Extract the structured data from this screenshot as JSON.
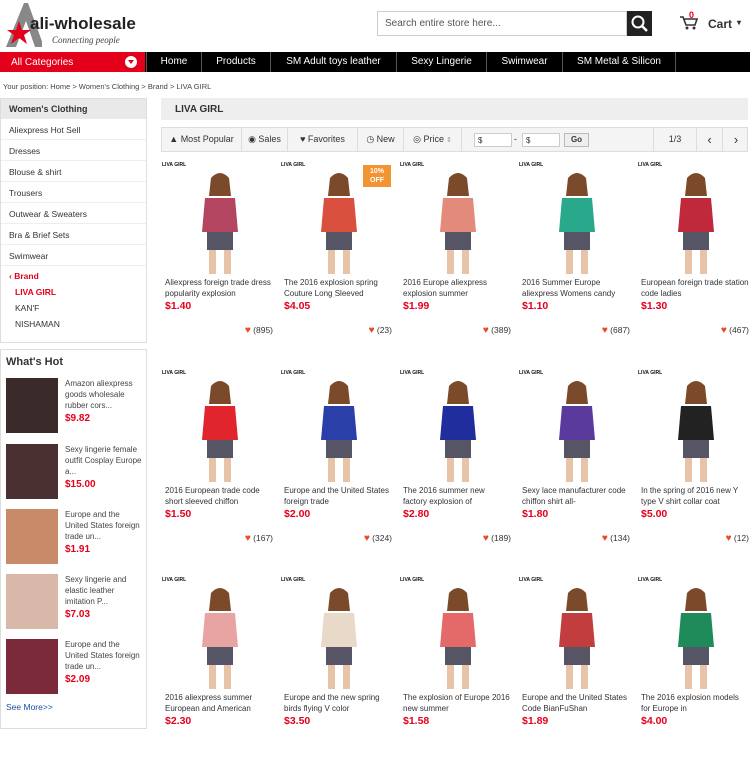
{
  "header": {
    "logo_name": "ali-wholesale",
    "logo_tagline": "Connecting people",
    "search_placeholder": "Search entire store here...",
    "cart_label": "Cart"
  },
  "nav": {
    "all_categories": "All Categories",
    "items": [
      "Home",
      "Products",
      "SM Adult toys leather",
      "Sexy Lingerie",
      "Swimwear",
      "SM Metal & Silicon"
    ]
  },
  "breadcrumb": "Your position: Home > Women's Clothing > Brand > LIVA GIRL",
  "sidebar": {
    "heading": "Women's Clothing",
    "items": [
      "Aliexpress Hot Sell",
      "Dresses",
      "Blouse & shirt",
      "Trousers",
      "Outwear & Sweaters",
      "Bra & Brief Sets",
      "Swimwear"
    ],
    "brand_label": "Brand",
    "brands": [
      "LIVA GIRL",
      "KAN'F",
      "NISHAMAN"
    ]
  },
  "whats_hot": {
    "title": "What's Hot",
    "items": [
      {
        "title": "Amazon aliexpress goods wholesale rubber cors...",
        "price": "$9.82"
      },
      {
        "title": "Sexy lingerie female outfit Cosplay Europe a...",
        "price": "$15.00"
      },
      {
        "title": "Europe and the United States foreign trade un...",
        "price": "$1.91"
      },
      {
        "title": "Sexy lingerie and elastic leather imitation P...",
        "price": "$7.03"
      },
      {
        "title": "Europe and the United States foreign trade un...",
        "price": "$2.09"
      }
    ],
    "see_more": "See More>>"
  },
  "listing": {
    "title": "LIVA GIRL",
    "sort": {
      "most_popular": "Most Popular",
      "sales": "Sales",
      "favorites": "Favorites",
      "new": "New",
      "price": "Price",
      "min_placeholder": "$",
      "max_placeholder": "$",
      "dash": "-",
      "go": "Go",
      "page": "1/3"
    },
    "brand_tag": "LIVA GIRL",
    "badge": {
      "pct": "10%",
      "off": "OFF"
    },
    "products": [
      {
        "title": "Aliexpress foreign trade dress popularity explosion",
        "price": "$1.40",
        "likes": "(895)",
        "color": "#b44560"
      },
      {
        "title": "The 2016 explosion spring Couture Long Sleeved",
        "price": "$4.05",
        "likes": "(23)",
        "color": "#d9503e"
      },
      {
        "title": "2016 Europe aliexpress explosion summer",
        "price": "$1.99",
        "likes": "(389)",
        "color": "#e48a7a"
      },
      {
        "title": "2016 Summer Europe aliexpress Womens candy",
        "price": "$1.10",
        "likes": "(687)",
        "color": "#2aa88c"
      },
      {
        "title": "European foreign trade station code ladies",
        "price": "$1.30",
        "likes": "(467)",
        "color": "#c0283c"
      },
      {
        "title": "2016 European trade code short sleeved chiffon",
        "price": "$1.50",
        "likes": "(167)",
        "color": "#e0262c"
      },
      {
        "title": "Europe and the United States foreign trade",
        "price": "$2.00",
        "likes": "(324)",
        "color": "#2a3fa8"
      },
      {
        "title": "The 2016 summer new factory explosion of",
        "price": "$2.80",
        "likes": "(189)",
        "color": "#1f2e9c"
      },
      {
        "title": "Sexy lace manufacturer code chiffon shirt all-",
        "price": "$1.80",
        "likes": "(134)",
        "color": "#5b3a9e"
      },
      {
        "title": "In the spring of 2016 new Y type V shirt collar coat",
        "price": "$5.00",
        "likes": "(12)",
        "color": "#222222"
      },
      {
        "title": "2016 aliexpress summer European and American",
        "price": "$2.30",
        "likes": "",
        "color": "#e8a3a3"
      },
      {
        "title": "Europe and the new spring birds flying V color",
        "price": "$3.50",
        "likes": "",
        "color": "#e9d9c9"
      },
      {
        "title": "The explosion of Europe 2016 new summer",
        "price": "$1.58",
        "likes": "",
        "color": "#e46a6a"
      },
      {
        "title": "Europe and the United States Code BianFuShan",
        "price": "$1.89",
        "likes": "",
        "color": "#c23d3d"
      },
      {
        "title": "The 2016 explosion models for Europe in",
        "price": "$4.00",
        "likes": "",
        "color": "#1f8a5a"
      }
    ]
  }
}
